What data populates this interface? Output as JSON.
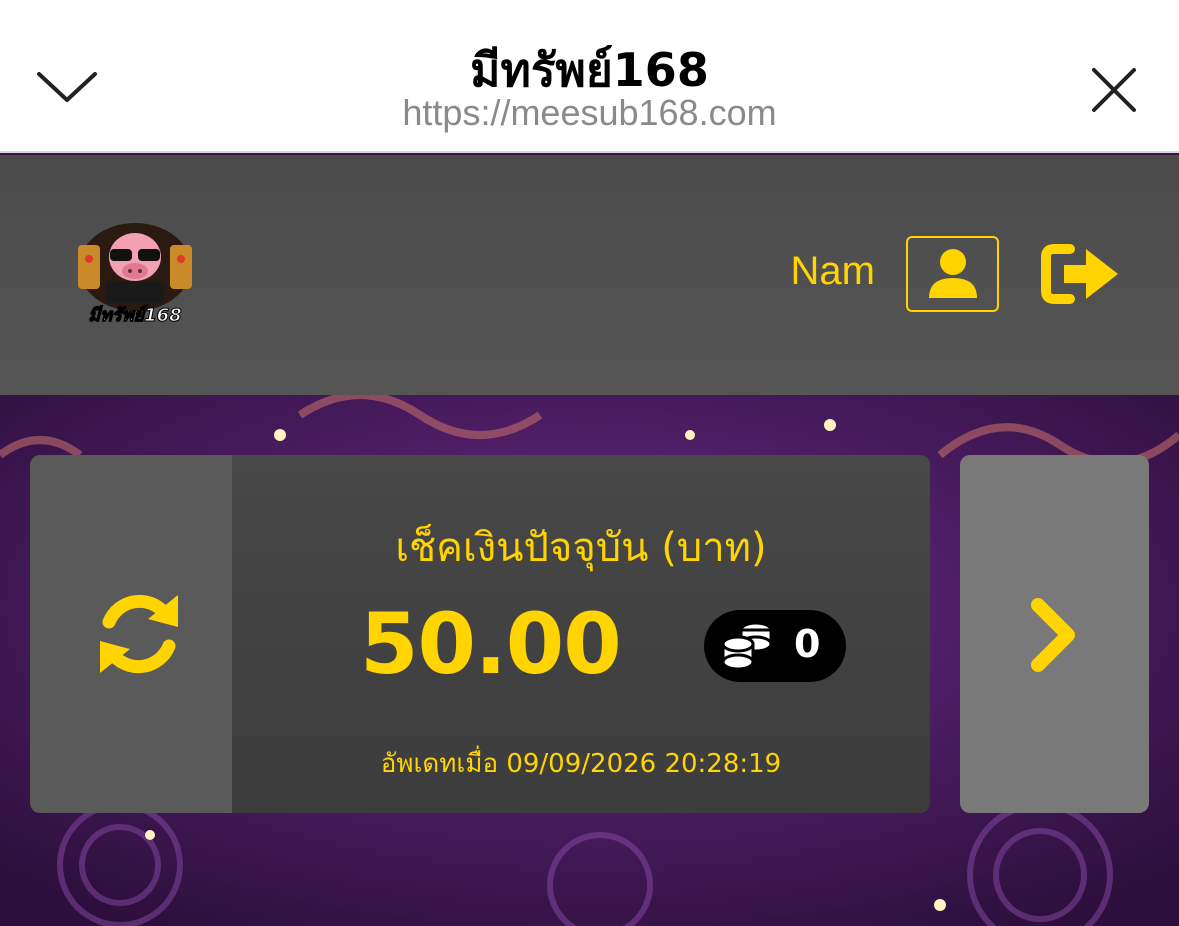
{
  "browser": {
    "title": "มีทรัพย์168",
    "url": "https://meesub168.com"
  },
  "header": {
    "logo_text": "มีทรัพย์168",
    "username": "Nam",
    "icons": {
      "collapse": "chevron-down-icon",
      "close": "close-icon",
      "profile": "user-icon",
      "logout": "logout-icon"
    }
  },
  "wallet": {
    "label": "เช็คเงินปัจจุบัน (บาท)",
    "balance": "50.00",
    "coins": "0",
    "updated": "อัพเดทเมื่อ 09/09/2026 20:28:19",
    "icons": {
      "refresh": "refresh-icon",
      "next": "chevron-right-icon",
      "coins": "coin-stack-icon"
    }
  },
  "colors": {
    "accent": "#ffd400",
    "header_bg": "#4f4f4f",
    "background": "#3a1450"
  }
}
